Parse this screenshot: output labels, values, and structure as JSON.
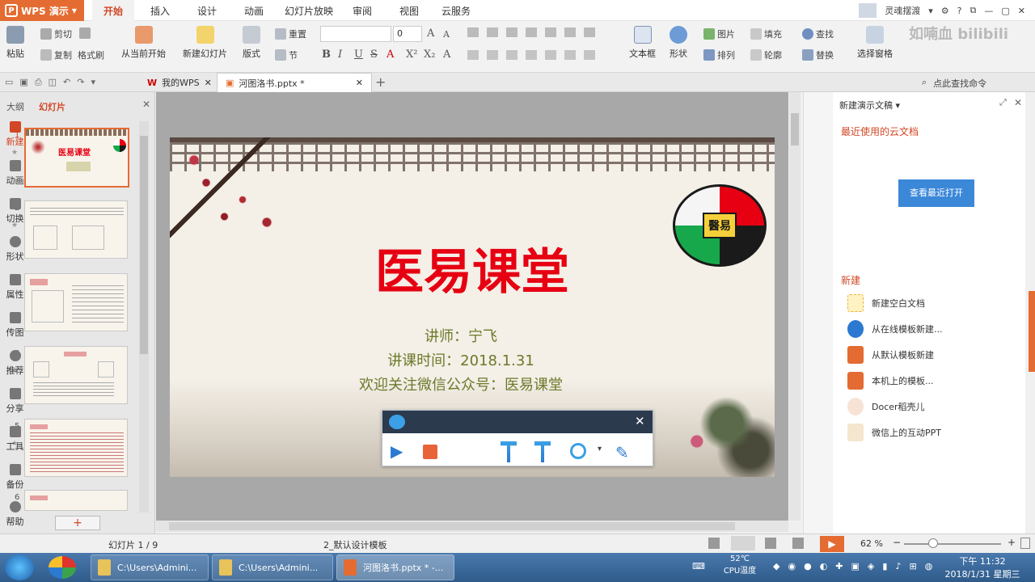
{
  "app": {
    "name": "WPS 演示"
  },
  "menu": {
    "tabs": [
      "开始",
      "插入",
      "设计",
      "动画",
      "幻灯片放映",
      "审阅",
      "视图",
      "云服务"
    ],
    "active": "开始"
  },
  "user": {
    "name": "灵魂摆渡"
  },
  "ribbon": {
    "paste": "粘贴",
    "cut": "剪切",
    "copy": "复制",
    "format_painter": "格式刷",
    "from_current": "从当前开始",
    "new_slide": "新建幻灯片",
    "layout": "版式",
    "reset": "重置",
    "section": "节",
    "font_size": "0",
    "text_box": "文本框",
    "shape": "形状",
    "picture": "图片",
    "fill": "填充",
    "arrange": "排列",
    "outline": "轮廓",
    "find": "查找",
    "replace": "替换",
    "selection_pane": "选择窗格",
    "find_command": "点此查找命令"
  },
  "tabs": [
    {
      "label": "我的WPS"
    },
    {
      "label": "河图洛书.pptx *"
    }
  ],
  "left_panel": {
    "outline_tab": "大纲",
    "slides_tab": "幻灯片",
    "slide_numbers": [
      "1",
      "2",
      "3",
      "4",
      "5",
      "6"
    ],
    "add_button": "+"
  },
  "slide": {
    "title": "医易课堂",
    "lecturer": "讲师：宁飞",
    "time": "讲课时间：2018.1.31",
    "follow": "欢迎关注微信公众号：医易课堂",
    "thumb_title": "医易课堂"
  },
  "right_panel": {
    "header": "新建演示文稿",
    "recent_cloud": "最近使用的云文档",
    "view_recent_button": "查看最近打开",
    "new_section": "新建",
    "items": [
      "新建空白文档",
      "从在线模板新建...",
      "从默认模板新建",
      "本机上的模板...",
      "Docer稻壳儿",
      "微信上的互动PPT"
    ],
    "sidebar": [
      "新建",
      "动画",
      "切换",
      "形状",
      "属性",
      "传图",
      "推荐",
      "分享",
      "工具",
      "备份",
      "帮助"
    ]
  },
  "status": {
    "slide_info": "幻灯片 1 / 9",
    "template": "2_默认设计模板",
    "zoom": "62 %"
  },
  "taskbar": {
    "items": [
      "C:\\Users\\Admini...",
      "C:\\Users\\Admini...",
      "河图洛书.pptx * -..."
    ],
    "temp": "52℃",
    "cpu_label": "CPU温度",
    "time": "下午 11:32",
    "date": "2018/1/31 星期三"
  },
  "watermark": "如喃血 bilibili",
  "colors": {
    "accent": "#e46c32",
    "title_red": "#e60012",
    "subtitle_olive": "#6b7a2a",
    "blue_button": "#3b87d8"
  }
}
